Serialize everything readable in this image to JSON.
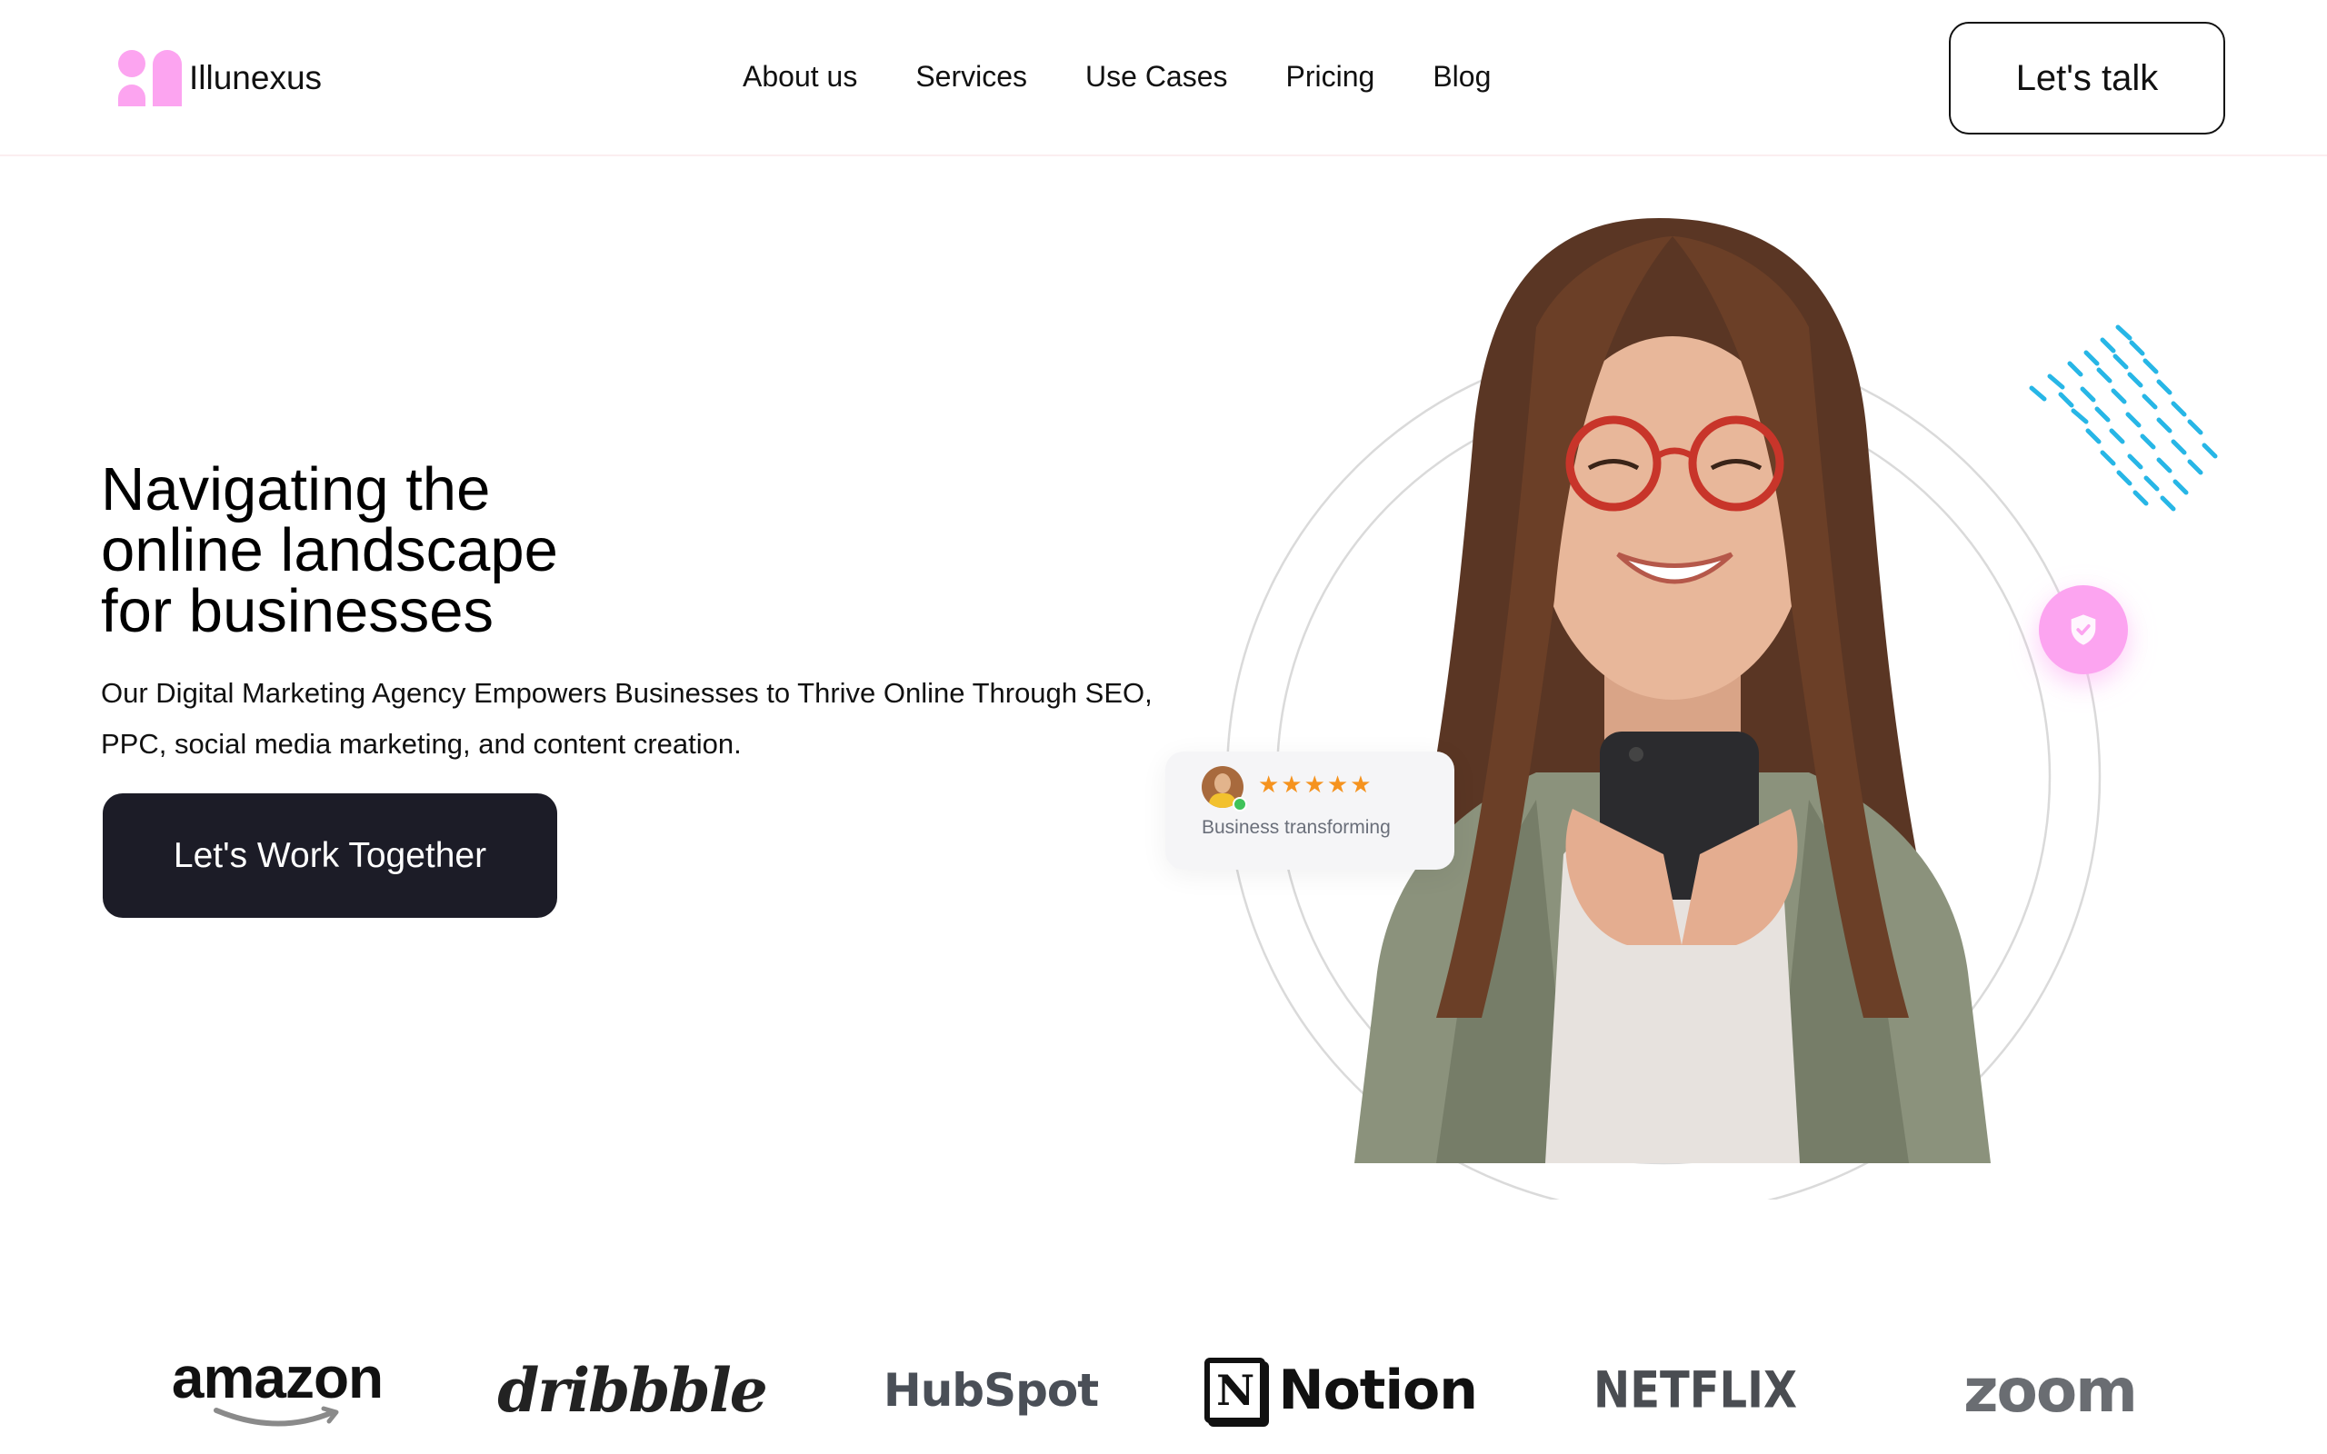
{
  "header": {
    "brand_name": "Illunexus",
    "nav": [
      "About us",
      "Services",
      "Use Cases",
      "Pricing",
      "Blog"
    ],
    "cta_label": "Let's talk"
  },
  "hero": {
    "title_line1": "Navigating the",
    "title_line2": "online landscape",
    "title_line3": "for businesses",
    "subtitle": "Our Digital Marketing Agency Empowers Businesses to Thrive Online Through SEO, PPC, social media marketing, and content creation.",
    "cta_label": "Let's Work Together"
  },
  "rating_card": {
    "stars": "★★★★★",
    "rating": 5,
    "caption": "Business transforming"
  },
  "brands": {
    "amazon": "amazon",
    "dribbble": "dribbble",
    "hubspot": "HubSpot",
    "notion": "Notion",
    "netflix": "NETFLIX",
    "zoom": "zoom"
  },
  "colors": {
    "accent_pink": "#fca4f0",
    "dark_button": "#1c1c27",
    "dash_blue": "#27b6e6",
    "star_orange": "#f5931f"
  }
}
